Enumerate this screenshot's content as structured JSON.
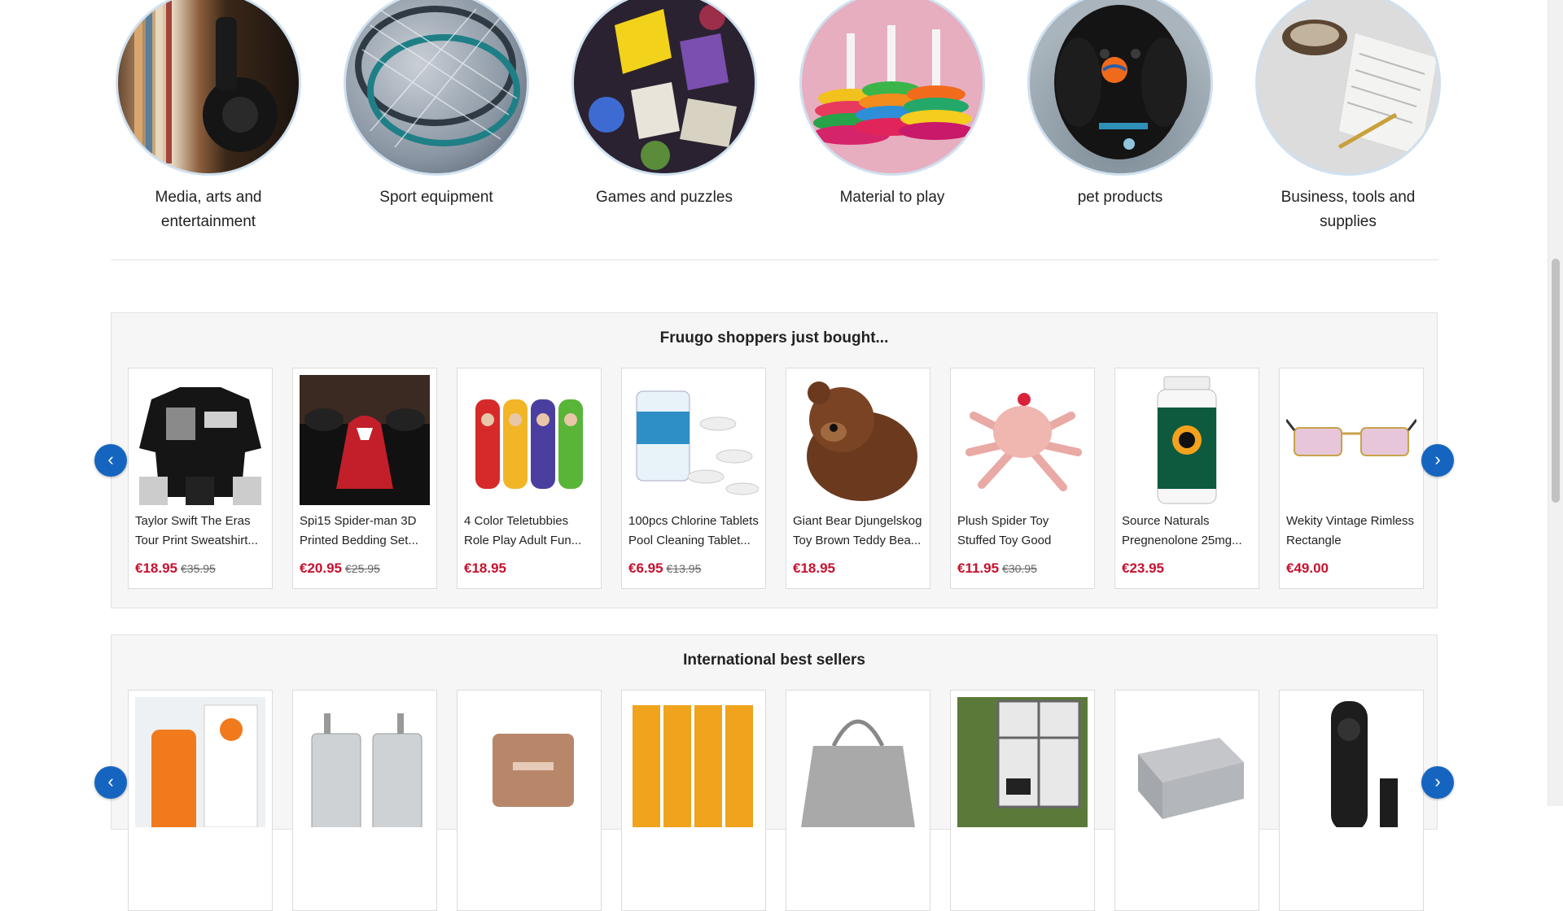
{
  "categories": [
    {
      "label": "Media, arts and entertainment",
      "icon": "headphones-books-image"
    },
    {
      "label": "Sport equipment",
      "icon": "tennis-rackets-image"
    },
    {
      "label": "Games and puzzles",
      "icon": "dice-image"
    },
    {
      "label": "Material to play",
      "icon": "stacking-toy-image"
    },
    {
      "label": "pet products",
      "icon": "dog-image"
    },
    {
      "label": "Business, tools and supplies",
      "icon": "office-supplies-image"
    }
  ],
  "just_bought": {
    "title": "Fruugo shoppers just bought...",
    "products": [
      {
        "name": "Taylor Swift The Eras Tour Print Sweatshirt...",
        "price": "€18.95",
        "was": "€35.95",
        "icon": "sweatshirt-image"
      },
      {
        "name": "Spi15 Spider-man 3D Printed Bedding Set...",
        "price": "€20.95",
        "was": "€25.95",
        "icon": "bedding-image"
      },
      {
        "name": "4 Color Teletubbies Role Play Adult Fun...",
        "price": "€18.95",
        "was": "",
        "icon": "costume-image"
      },
      {
        "name": "100pcs Chlorine Tablets Pool Cleaning Tablet...",
        "price": "€6.95",
        "was": "€13.95",
        "icon": "tablets-image"
      },
      {
        "name": "Giant Bear Djungelskog Toy Brown Teddy Bea...",
        "price": "€18.95",
        "was": "",
        "icon": "teddy-bear-image"
      },
      {
        "name": "Plush Spider Toy Stuffed Toy Good Detail...",
        "price": "€11.95",
        "was": "€30.95",
        "icon": "plush-spider-image"
      },
      {
        "name": "Source Naturals Pregnenolone 25mg...",
        "price": "€23.95",
        "was": "",
        "icon": "supplement-bottle-image"
      },
      {
        "name": "Wekity Vintage Rimless Rectangle Sunglasses...",
        "price": "€49.00",
        "was": "",
        "icon": "sunglasses-image"
      }
    ]
  },
  "best_sellers": {
    "title": "International best sellers",
    "products": [
      {
        "icon": "sunscreen-image"
      },
      {
        "icon": "luggage-image"
      },
      {
        "icon": "portable-ssd-image"
      },
      {
        "icon": "ointment-tubes-image"
      },
      {
        "icon": "tote-bag-image"
      },
      {
        "icon": "ibc-tank-image"
      },
      {
        "icon": "furniture-cover-image"
      },
      {
        "icon": "remote-control-image"
      }
    ]
  },
  "nav": {
    "prev": "‹",
    "next": "›"
  },
  "colors": {
    "price": "#c8102e",
    "nav_button": "#1565c0",
    "panel": "#f6f6f6"
  }
}
